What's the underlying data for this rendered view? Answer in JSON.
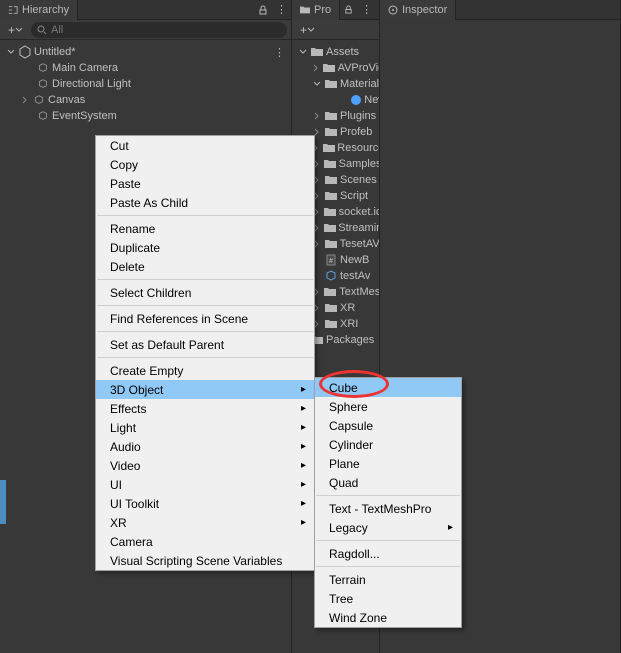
{
  "hierarchy": {
    "tab_label": "Hierarchy",
    "add_label": "+",
    "search_placeholder": "All",
    "scene_name": "Untitled*",
    "items": [
      {
        "label": "Main Camera"
      },
      {
        "label": "Directional Light"
      },
      {
        "label": "Canvas"
      },
      {
        "label": "EventSystem"
      }
    ]
  },
  "project_panel": {
    "tab_label": "Pro",
    "add_label": "+",
    "root_label": "Assets",
    "packages_label": "Packages",
    "items": [
      {
        "label": "AVProVic",
        "type": "folder"
      },
      {
        "label": "Material",
        "type": "folder",
        "expanded": true
      },
      {
        "label": "New M",
        "type": "material",
        "indent": 3
      },
      {
        "label": "Plugins",
        "type": "folder"
      },
      {
        "label": "Profeb",
        "type": "folder"
      },
      {
        "label": "Resource",
        "type": "folder"
      },
      {
        "label": "Samples",
        "type": "folder"
      },
      {
        "label": "Scenes",
        "type": "folder"
      },
      {
        "label": "Script",
        "type": "folder"
      },
      {
        "label": "socket.ic",
        "type": "folder"
      },
      {
        "label": "Streamin",
        "type": "folder"
      },
      {
        "label": "TesetAV",
        "type": "folder"
      },
      {
        "label": "NewB",
        "type": "script"
      },
      {
        "label": "testAv",
        "type": "prefab"
      },
      {
        "label": "TextMes",
        "type": "folder"
      },
      {
        "label": "XR",
        "type": "folder"
      },
      {
        "label": "XRI",
        "type": "folder"
      }
    ]
  },
  "inspector": {
    "tab_label": "Inspector"
  },
  "context_menu": {
    "groups": [
      [
        "Cut",
        "Copy",
        "Paste",
        "Paste As Child"
      ],
      [
        "Rename",
        "Duplicate",
        "Delete"
      ],
      [
        "Select Children"
      ],
      [
        "Find References in Scene"
      ],
      [
        "Set as Default Parent"
      ],
      [
        "Create Empty"
      ]
    ],
    "sub_items": [
      {
        "label": "3D Object",
        "highlighted": true
      },
      {
        "label": "Effects"
      },
      {
        "label": "Light"
      },
      {
        "label": "Audio"
      },
      {
        "label": "Video"
      },
      {
        "label": "UI"
      },
      {
        "label": "UI Toolkit"
      },
      {
        "label": "XR"
      }
    ],
    "tail_items": [
      "Camera",
      "Visual Scripting Scene Variables"
    ]
  },
  "submenu_3d": {
    "groups": [
      [
        "Cube",
        "Sphere",
        "Capsule",
        "Cylinder",
        "Plane",
        "Quad"
      ],
      [
        "Text - TextMeshPro"
      ]
    ],
    "legacy_label": "Legacy",
    "groups2": [
      [
        "Ragdoll..."
      ],
      [
        "Terrain",
        "Tree",
        "Wind Zone"
      ]
    ],
    "highlighted": "Cube"
  }
}
